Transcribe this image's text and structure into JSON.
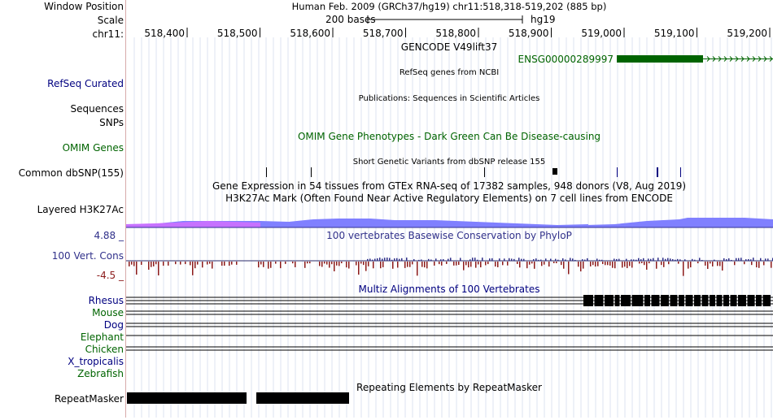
{
  "header": {
    "window_position_label": "Window Position",
    "scale_label": "Scale",
    "chrom_label": "chr11:",
    "title": "Human Feb. 2009 (GRCh37/hg19)   chr11:518,318-519,202 (885 bp)",
    "scale_text": "200 bases",
    "assembly": "hg19",
    "ruler_ticks": [
      "518,400",
      "518,500",
      "518,600",
      "518,700",
      "518,800",
      "518,900",
      "519,000",
      "519,100",
      "519,200"
    ]
  },
  "tracks": {
    "gencode": {
      "title": "GENCODE V49lift37",
      "gene": "ENSG00000289997",
      "color": "#006400"
    },
    "refseq": {
      "label": "RefSeq Curated",
      "title": "RefSeq genes from NCBI"
    },
    "publications": {
      "label": "Sequences",
      "title": "Publications: Sequences in Scientific Articles"
    },
    "snps_group": {
      "label": "SNPs"
    },
    "omim": {
      "label": "OMIM Genes",
      "title": "OMIM Gene Phenotypes - Dark Green Can Be Disease-causing",
      "color": "#006400"
    },
    "dbsnp": {
      "label": "Common dbSNP(155)",
      "title": "Short Genetic Variants from dbSNP release 155"
    },
    "gtex": {
      "title": "Gene Expression in 54 tissues from GTEx RNA-seq of 17382 samples, 948 donors (V8, Aug 2019)"
    },
    "h3k27ac": {
      "label": "Layered H3K27Ac",
      "title": "H3K27Ac Mark (Often Found Near Active Regulatory Elements) on 7 cell lines from ENCODE"
    },
    "conservation": {
      "label": "100 Vert. Cons",
      "max": "4.88 _",
      "min": "-4.5 _",
      "title": "100 vertebrates Basewise Conservation by PhyloP",
      "color": "#30308a"
    },
    "multiz": {
      "title": "Multiz Alignments of 100 Vertebrates",
      "species": [
        {
          "name": "Rhesus",
          "color": "#000080"
        },
        {
          "name": "Mouse",
          "color": "#006400"
        },
        {
          "name": "Dog",
          "color": "#000080"
        },
        {
          "name": "Elephant",
          "color": "#006400"
        },
        {
          "name": "Chicken",
          "color": "#006400"
        },
        {
          "name": "X_tropicalis",
          "color": "#000080"
        },
        {
          "name": "Zebrafish",
          "color": "#006400"
        }
      ]
    },
    "repeatmasker": {
      "label": "RepeatMasker",
      "title": "Repeating Elements by RepeatMasker"
    }
  }
}
